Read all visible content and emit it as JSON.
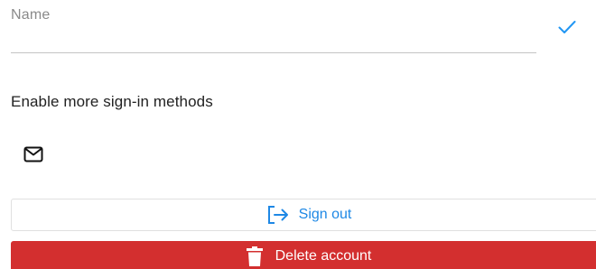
{
  "name_field": {
    "placeholder": "Name"
  },
  "confirm": {
    "icon": "check-icon",
    "color": "#2196f3"
  },
  "sign_in_methods": {
    "title": "Enable more sign-in methods",
    "methods": [
      {
        "icon": "mail-icon"
      }
    ]
  },
  "actions": {
    "sign_out_label": "Sign out",
    "sign_out_icon": "sign-out-icon",
    "delete_label": "Delete account",
    "delete_icon": "trash-icon",
    "accent_color": "#1e88e5",
    "danger_color": "#d32f2f"
  }
}
